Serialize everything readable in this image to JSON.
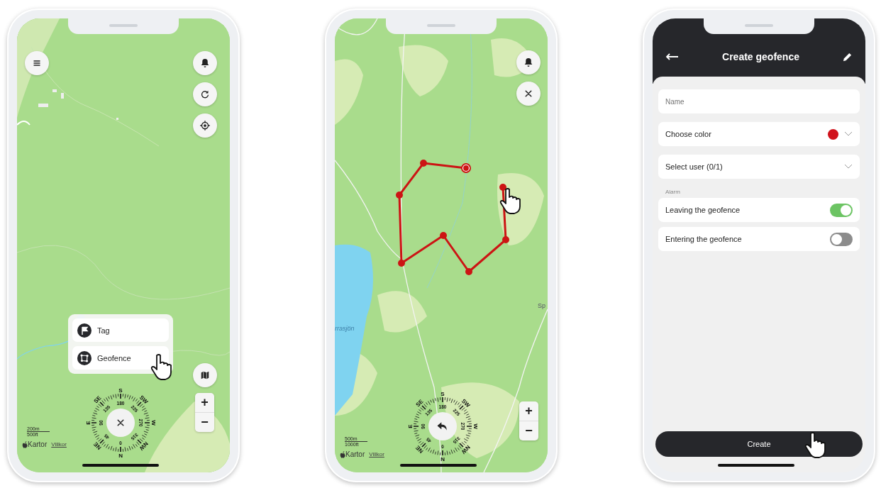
{
  "map_screen": {
    "add_menu": {
      "items": [
        {
          "label": "Tag",
          "kind": "tag"
        },
        {
          "label": "Geofence",
          "kind": "geofence"
        }
      ]
    },
    "compass": {
      "directions": [
        "N",
        "NE",
        "E",
        "SE",
        "S",
        "SW",
        "W",
        "NW"
      ],
      "degrees": [
        "0",
        "45",
        "90",
        "135",
        "180",
        "225",
        "270",
        "315"
      ]
    },
    "zoom": {
      "in": "+",
      "out": "−"
    },
    "scale": [
      "200m",
      "500ft"
    ],
    "attribution": {
      "brand": "Kartor",
      "link": "Villkor"
    }
  },
  "draw_screen": {
    "place_labels": [
      "Sp",
      "rrasjön"
    ],
    "compass": {
      "directions": [
        "N",
        "NE",
        "E",
        "SE",
        "S",
        "SW",
        "W",
        "NW"
      ],
      "degrees": [
        "0",
        "45",
        "90",
        "135",
        "180",
        "225",
        "270",
        "315"
      ]
    },
    "zoom": {
      "in": "+",
      "out": "−"
    },
    "scale": [
      "500m",
      "1000ft"
    ],
    "attribution": {
      "brand": "Kartor",
      "link": "Villkor"
    }
  },
  "form_screen": {
    "title": "Create geofence",
    "fields": [
      {
        "kind": "text",
        "placeholder": "Name"
      },
      {
        "kind": "select",
        "label": "Choose color",
        "color": "#d0121b"
      },
      {
        "kind": "select",
        "label": "Select user (0/1)"
      }
    ],
    "section": "Alarm",
    "toggles": [
      {
        "label": "Leaving the geofence",
        "on": true
      },
      {
        "label": "Entering the geofence",
        "on": false
      }
    ],
    "button": "Create"
  }
}
